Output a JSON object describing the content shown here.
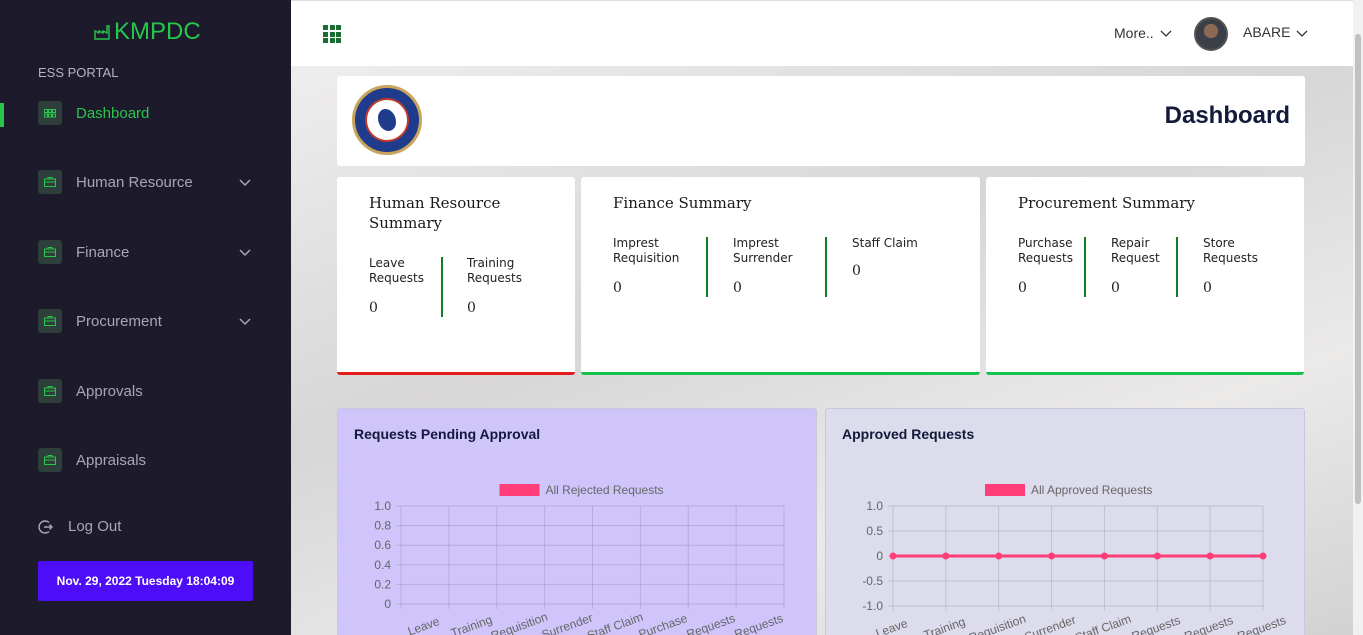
{
  "brand": {
    "name": "KMPDC",
    "portal": "ESS PORTAL"
  },
  "sidebar": {
    "items": [
      {
        "label": "Dashboard",
        "active": true,
        "has_submenu": false
      },
      {
        "label": "Human Resource",
        "active": false,
        "has_submenu": true
      },
      {
        "label": "Finance",
        "active": false,
        "has_submenu": true
      },
      {
        "label": "Procurement",
        "active": false,
        "has_submenu": true
      },
      {
        "label": "Approvals",
        "active": false,
        "has_submenu": false
      },
      {
        "label": "Appraisals",
        "active": false,
        "has_submenu": false
      }
    ],
    "logout_label": "Log Out",
    "datetime": "Nov. 29, 2022 Tuesday 18:04:09"
  },
  "topbar": {
    "more_label": "More..",
    "user_name": "ABARE"
  },
  "header": {
    "title": "Dashboard"
  },
  "summaries": [
    {
      "title": "Human Resource Summary",
      "accent": "#e21c1c",
      "stats": [
        {
          "label": "Leave Requests",
          "value": "0"
        },
        {
          "label": "Training Requests",
          "value": "0"
        }
      ]
    },
    {
      "title": "Finance Summary",
      "accent": "#17c24a",
      "stats": [
        {
          "label": "Imprest Requisition",
          "value": "0"
        },
        {
          "label": "Imprest Surrender",
          "value": "0"
        },
        {
          "label": "Staff Claim",
          "value": "0"
        }
      ]
    },
    {
      "title": "Procurement Summary",
      "accent": "#17c24a",
      "stats": [
        {
          "label": "Purchase Requests",
          "value": "0"
        },
        {
          "label": "Repair Request",
          "value": "0"
        },
        {
          "label": "Store Requests",
          "value": "0"
        }
      ]
    }
  ],
  "charts": {
    "pending": {
      "title": "Requests Pending Approval"
    },
    "approved": {
      "title": "Approved Requests"
    }
  },
  "chart_data": [
    {
      "type": "bar",
      "title": "Requests Pending Approval",
      "categories": [
        "Leave",
        "Training",
        "Requisition",
        "Surrender",
        "Staff Claim",
        "Purchase",
        "Requests",
        "Requests"
      ],
      "series": [
        {
          "name": "All Rejected Requests",
          "values": [
            0,
            0,
            0,
            0,
            0,
            0,
            0,
            0
          ],
          "color": "#ff3d79"
        }
      ],
      "ylim": [
        0,
        1.0
      ],
      "yticks": [
        "1.0",
        "0.8",
        "0.6",
        "0.4",
        "0.2",
        "0"
      ],
      "grid": true,
      "legend": "top-center"
    },
    {
      "type": "line",
      "title": "Approved Requests",
      "categories": [
        "Leave",
        "Training",
        "Requisition",
        "Surrender",
        "Staff Claim",
        "Requests",
        "Requests",
        "Requests"
      ],
      "series": [
        {
          "name": "All Approved Requests",
          "values": [
            0,
            0,
            0,
            0,
            0,
            0,
            0,
            0
          ],
          "color": "#ff3d79"
        }
      ],
      "ylim": [
        -1.0,
        1.0
      ],
      "yticks": [
        "1.0",
        "0.5",
        "0",
        "-0.5",
        "-1.0"
      ],
      "grid": true,
      "legend": "top-center"
    }
  ]
}
